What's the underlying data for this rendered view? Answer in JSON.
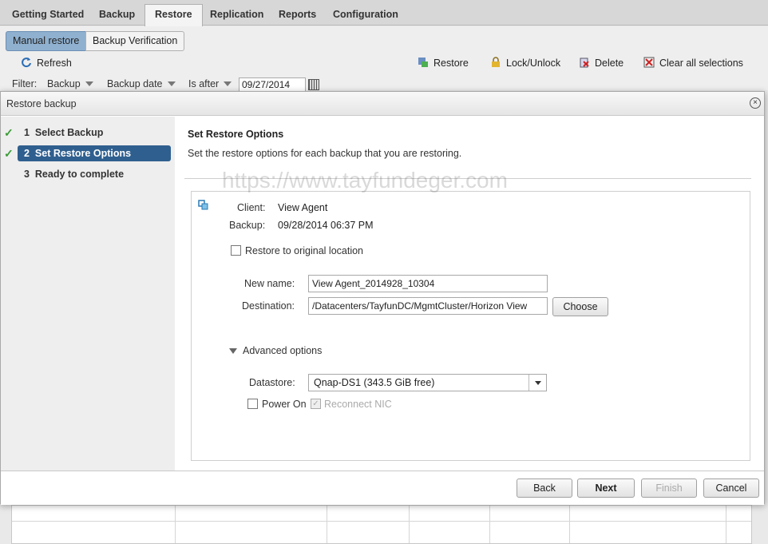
{
  "tabs": [
    "Getting Started",
    "Backup",
    "Restore",
    "Replication",
    "Reports",
    "Configuration"
  ],
  "subtabs": {
    "manual": "Manual restore",
    "verification": "Backup Verification"
  },
  "toolbar": {
    "refresh": "Refresh",
    "restore": "Restore",
    "lock": "Lock/Unlock",
    "delete": "Delete",
    "clear": "Clear all selections"
  },
  "filter": {
    "label": "Filter:",
    "backup": "Backup",
    "backup_date": "Backup date",
    "is_after": "Is after",
    "date": "09/27/2014"
  },
  "dialog": {
    "title": "Restore backup",
    "close": "×",
    "steps": [
      {
        "num": "1",
        "label": "Select Backup"
      },
      {
        "num": "2",
        "label": "Set Restore Options"
      },
      {
        "num": "3",
        "label": "Ready to complete"
      }
    ],
    "heading": "Set Restore Options",
    "description": "Set the restore options for each backup that you are restoring.",
    "client_label": "Client:",
    "client_value": "View Agent",
    "backup_label": "Backup:",
    "backup_value": "09/28/2014 06:37 PM",
    "restore_original": "Restore to original location",
    "new_name_label": "New name:",
    "new_name_value": "View Agent_2014928_10304",
    "destination_label": "Destination:",
    "destination_value": "/Datacenters/TayfunDC/MgmtCluster/Horizon View",
    "choose": "Choose",
    "advanced": "Advanced options",
    "datastore_label": "Datastore:",
    "datastore_value": "Qnap-DS1 (343.5 GiB free)",
    "power_on": "Power On",
    "reconnect_nic": "Reconnect NIC",
    "buttons": {
      "back": "Back",
      "next": "Next",
      "finish": "Finish",
      "cancel": "Cancel"
    }
  },
  "watermark": "https://www.tayfundeger.com"
}
